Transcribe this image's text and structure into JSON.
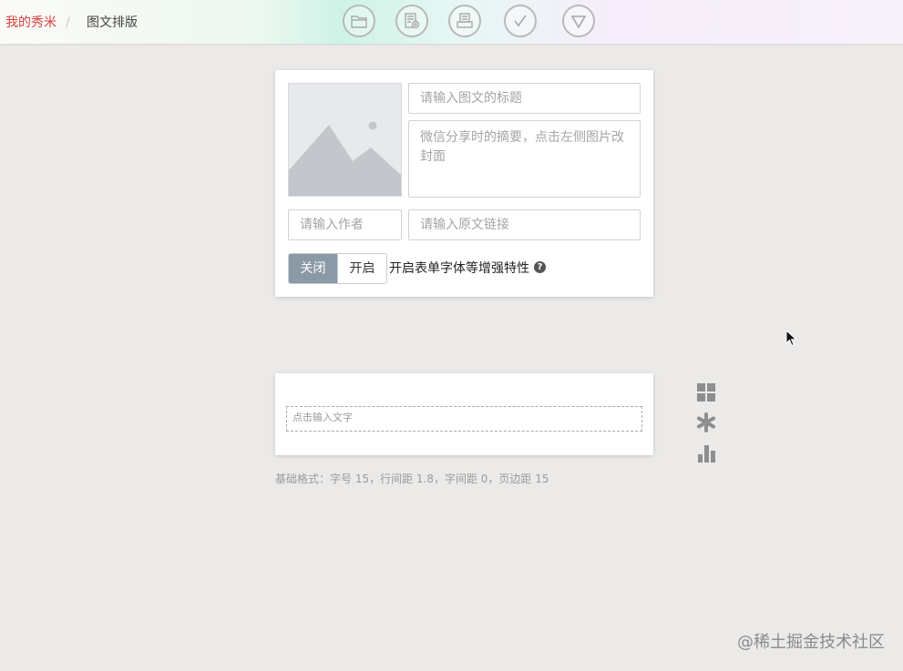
{
  "breadcrumb": {
    "home": "我的秀米",
    "separator": "/",
    "current": "图文排版"
  },
  "toolbar": {
    "buttons": [
      {
        "icon": "folder-icon"
      },
      {
        "icon": "preview-icon"
      },
      {
        "icon": "save-icon"
      },
      {
        "icon": "check-icon"
      },
      {
        "icon": "dropdown-icon"
      }
    ]
  },
  "meta_form": {
    "title_placeholder": "请输入图文的标题",
    "summary_placeholder": "微信分享时的摘要，点击左侧图片改封面",
    "author_placeholder": "请输入作者",
    "link_placeholder": "请输入原文链接",
    "toggle_off_label": "关闭",
    "toggle_on_label": "开启",
    "enhance_label": "开启表单字体等增强特性",
    "help_symbol": "?"
  },
  "editor": {
    "placeholder": "点击输入文字"
  },
  "format_info": "基础格式：字号 15，行间距 1.8，字间距 0，页边距 15",
  "side_tools": [
    {
      "icon": "grid-icon"
    },
    {
      "icon": "asterisk-icon"
    },
    {
      "icon": "bar-chart-icon"
    }
  ],
  "watermark": "@稀土掘金技术社区",
  "colors": {
    "accent_red": "#d8403f",
    "toggle_active": "#8b98a5",
    "background": "#ebeae8"
  }
}
